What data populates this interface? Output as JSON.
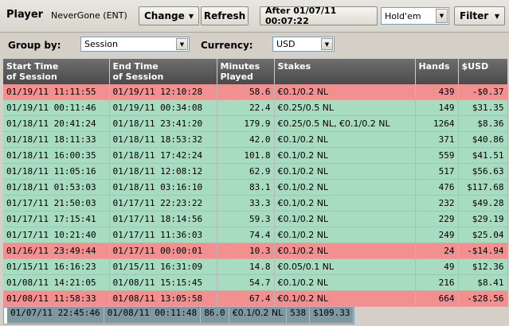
{
  "header": {
    "player_label": "Player",
    "player_name": "NeverGone (ENT)",
    "change_label": "Change",
    "refresh_label": "Refresh",
    "date_filter_label": "After 01/07/11 00:07:22",
    "game_select": "Hold'em",
    "filter_label": "Filter"
  },
  "groupbar": {
    "group_by_label": "Group by:",
    "group_by_value": "Session",
    "currency_label": "Currency:",
    "currency_value": "USD"
  },
  "table": {
    "columns": [
      "Start Time of Session",
      "End Time of Session",
      "Minutes Played",
      "Stakes",
      "Hands",
      "$USD"
    ],
    "column_lines": [
      [
        "Start Time",
        "of Session"
      ],
      [
        "End Time",
        "of Session"
      ],
      [
        "Minutes",
        "Played"
      ],
      [
        "Stakes"
      ],
      [
        "Hands"
      ],
      [
        "$USD"
      ]
    ],
    "rows": [
      {
        "start": "01/19/11 11:11:55",
        "end": "01/19/11 12:10:28",
        "minutes": "58.6",
        "stakes": "€0.1/0.2 NL",
        "hands": "439",
        "usd": "-$0.37",
        "type": "loss"
      },
      {
        "start": "01/19/11 00:11:46",
        "end": "01/19/11 00:34:08",
        "minutes": "22.4",
        "stakes": "€0.25/0.5 NL",
        "hands": "149",
        "usd": "$31.35",
        "type": "win"
      },
      {
        "start": "01/18/11 20:41:24",
        "end": "01/18/11 23:41:20",
        "minutes": "179.9",
        "stakes": "€0.25/0.5 NL, €0.1/0.2 NL",
        "hands": "1264",
        "usd": "$8.36",
        "type": "win"
      },
      {
        "start": "01/18/11 18:11:33",
        "end": "01/18/11 18:53:32",
        "minutes": "42.0",
        "stakes": "€0.1/0.2 NL",
        "hands": "371",
        "usd": "$40.86",
        "type": "win"
      },
      {
        "start": "01/18/11 16:00:35",
        "end": "01/18/11 17:42:24",
        "minutes": "101.8",
        "stakes": "€0.1/0.2 NL",
        "hands": "559",
        "usd": "$41.51",
        "type": "win"
      },
      {
        "start": "01/18/11 11:05:16",
        "end": "01/18/11 12:08:12",
        "minutes": "62.9",
        "stakes": "€0.1/0.2 NL",
        "hands": "517",
        "usd": "$56.63",
        "type": "win"
      },
      {
        "start": "01/18/11 01:53:03",
        "end": "01/18/11 03:16:10",
        "minutes": "83.1",
        "stakes": "€0.1/0.2 NL",
        "hands": "476",
        "usd": "$117.68",
        "type": "win"
      },
      {
        "start": "01/17/11 21:50:03",
        "end": "01/17/11 22:23:22",
        "minutes": "33.3",
        "stakes": "€0.1/0.2 NL",
        "hands": "232",
        "usd": "$49.28",
        "type": "win"
      },
      {
        "start": "01/17/11 17:15:41",
        "end": "01/17/11 18:14:56",
        "minutes": "59.3",
        "stakes": "€0.1/0.2 NL",
        "hands": "229",
        "usd": "$29.19",
        "type": "win"
      },
      {
        "start": "01/17/11 10:21:40",
        "end": "01/17/11 11:36:03",
        "minutes": "74.4",
        "stakes": "€0.1/0.2 NL",
        "hands": "249",
        "usd": "$25.04",
        "type": "win"
      },
      {
        "start": "01/16/11 23:49:44",
        "end": "01/17/11 00:00:01",
        "minutes": "10.3",
        "stakes": "€0.1/0.2 NL",
        "hands": "24",
        "usd": "-$14.94",
        "type": "loss"
      },
      {
        "start": "01/15/11 16:16:23",
        "end": "01/15/11 16:31:09",
        "minutes": "14.8",
        "stakes": "€0.05/0.1 NL",
        "hands": "49",
        "usd": "$12.36",
        "type": "win"
      },
      {
        "start": "01/08/11 14:21:05",
        "end": "01/08/11 15:15:45",
        "minutes": "54.7",
        "stakes": "€0.1/0.2 NL",
        "hands": "216",
        "usd": "$8.41",
        "type": "win"
      },
      {
        "start": "01/08/11 11:58:33",
        "end": "01/08/11 13:05:58",
        "minutes": "67.4",
        "stakes": "€0.1/0.2 NL",
        "hands": "664",
        "usd": "-$28.56",
        "type": "loss"
      },
      {
        "start": "01/07/11 22:45:46",
        "end": "01/08/11 00:11:48",
        "minutes": "86.0",
        "stakes": "€0.1/0.2 NL",
        "hands": "538",
        "usd": "$109.33",
        "type": "sel"
      }
    ]
  },
  "colors": {
    "win": "#a8dcc0",
    "loss": "#f29090",
    "selected": "#7d98a0",
    "header": "#555555"
  }
}
